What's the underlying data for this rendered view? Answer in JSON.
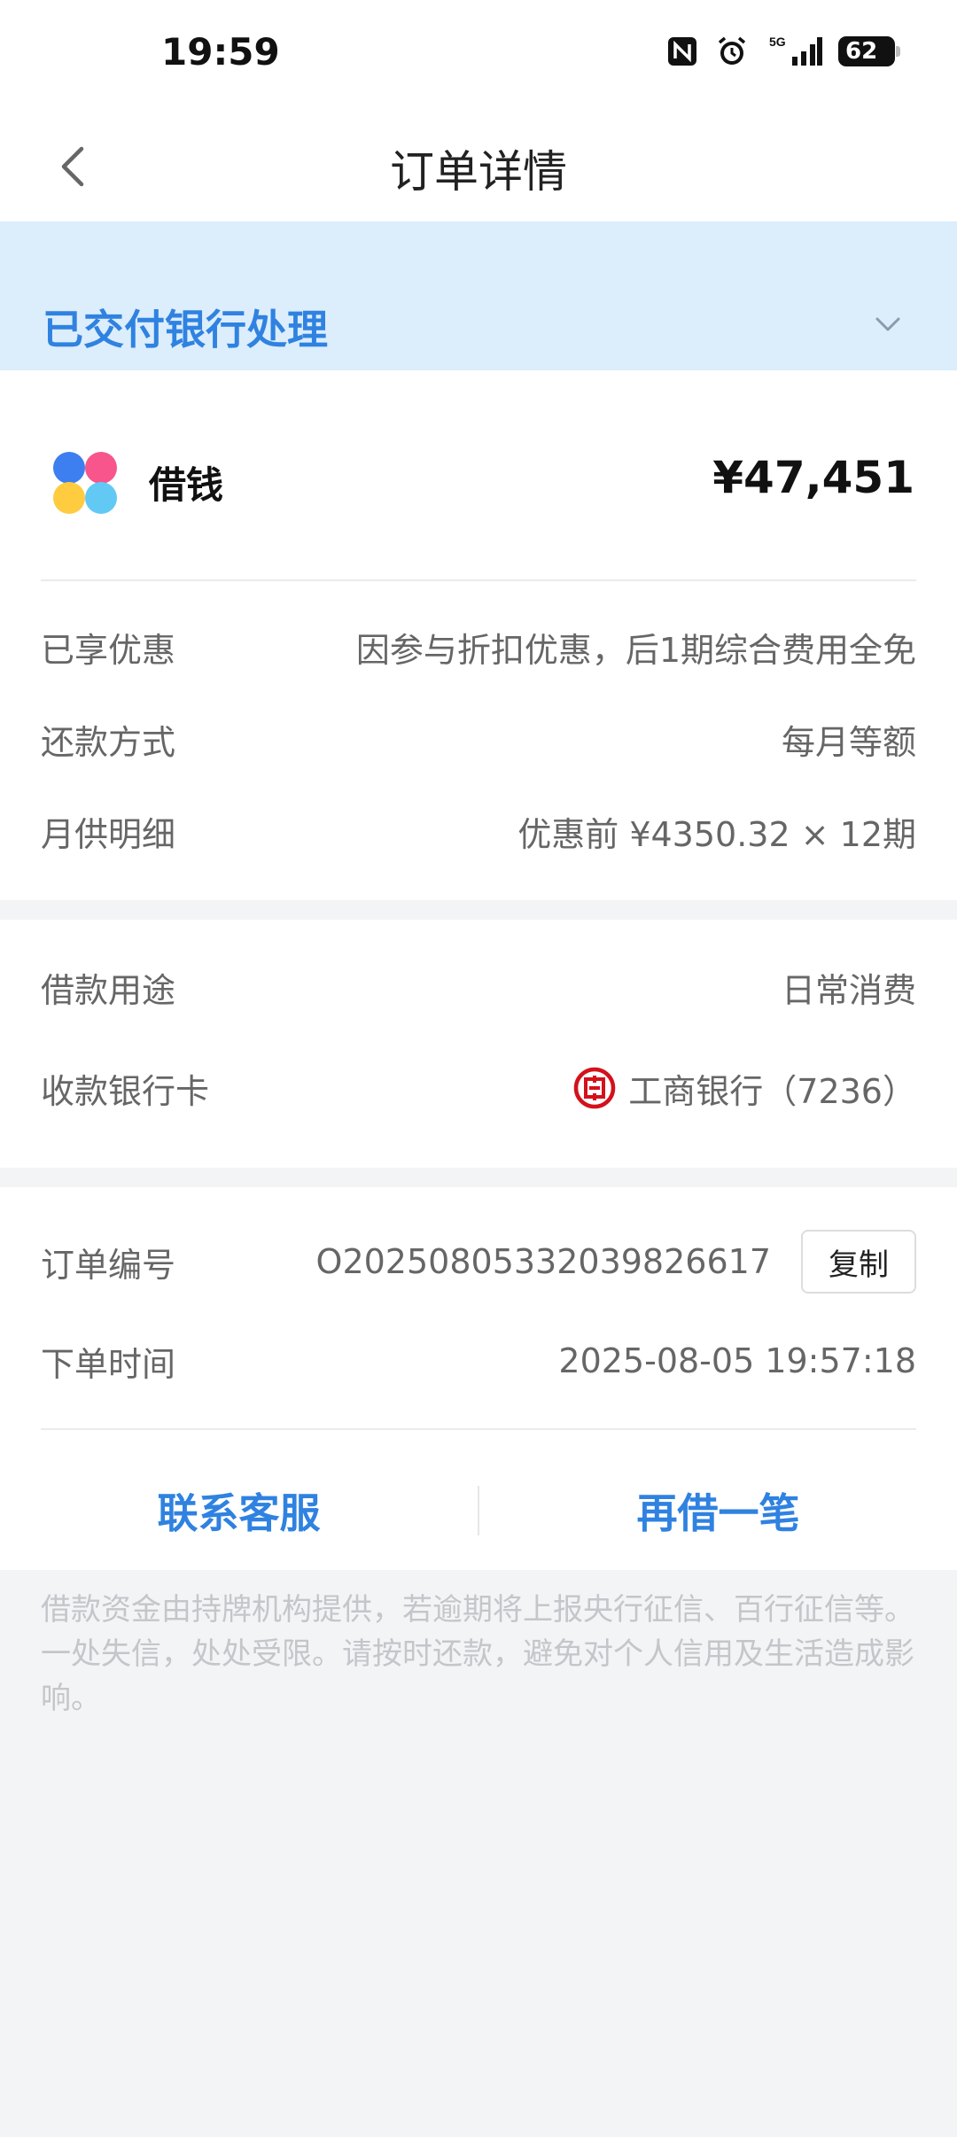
{
  "status_bar": {
    "time": "19:59",
    "battery": "62",
    "network": "5G",
    "icons": [
      "nfc-icon",
      "alarm-icon",
      "signal-icon",
      "battery-icon"
    ]
  },
  "nav": {
    "title": "订单详情",
    "back_icon": "chevron-left-icon"
  },
  "banner": {
    "status": "已交付银行处理",
    "color": "#2f82e0",
    "background": "#dcedfc"
  },
  "product": {
    "name": "借钱",
    "amount": "¥47,451",
    "logo_colors": [
      "#3d7ff0",
      "#f7558c",
      "#ffcb3f",
      "#62c9f5"
    ]
  },
  "details": [
    {
      "label": "已享优惠",
      "value": "因参与折扣优惠，后1期综合费用全免"
    },
    {
      "label": "还款方式",
      "value": "每月等额"
    },
    {
      "label": "月供明细",
      "value": "优惠前 ¥4350.32 × 12期"
    }
  ],
  "loan": {
    "purpose_label": "借款用途",
    "purpose_value": "日常消费",
    "card_label": "收款银行卡",
    "card_value": "工商银行（7236）",
    "bank_color": "#d4111b"
  },
  "order": {
    "number_label": "订单编号",
    "number_value": "O20250805332039826617",
    "copy_label": "复制",
    "time_label": "下单时间",
    "time_value": "2025-08-05 19:57:18"
  },
  "actions": {
    "contact": "联系客服",
    "borrow_again": "再借一笔"
  },
  "disclaimer": "借款资金由持牌机构提供，若逾期将上报央行征信、百行征信等。一处失信，处处受限。请按时还款，避免对个人信用及生活造成影响。"
}
